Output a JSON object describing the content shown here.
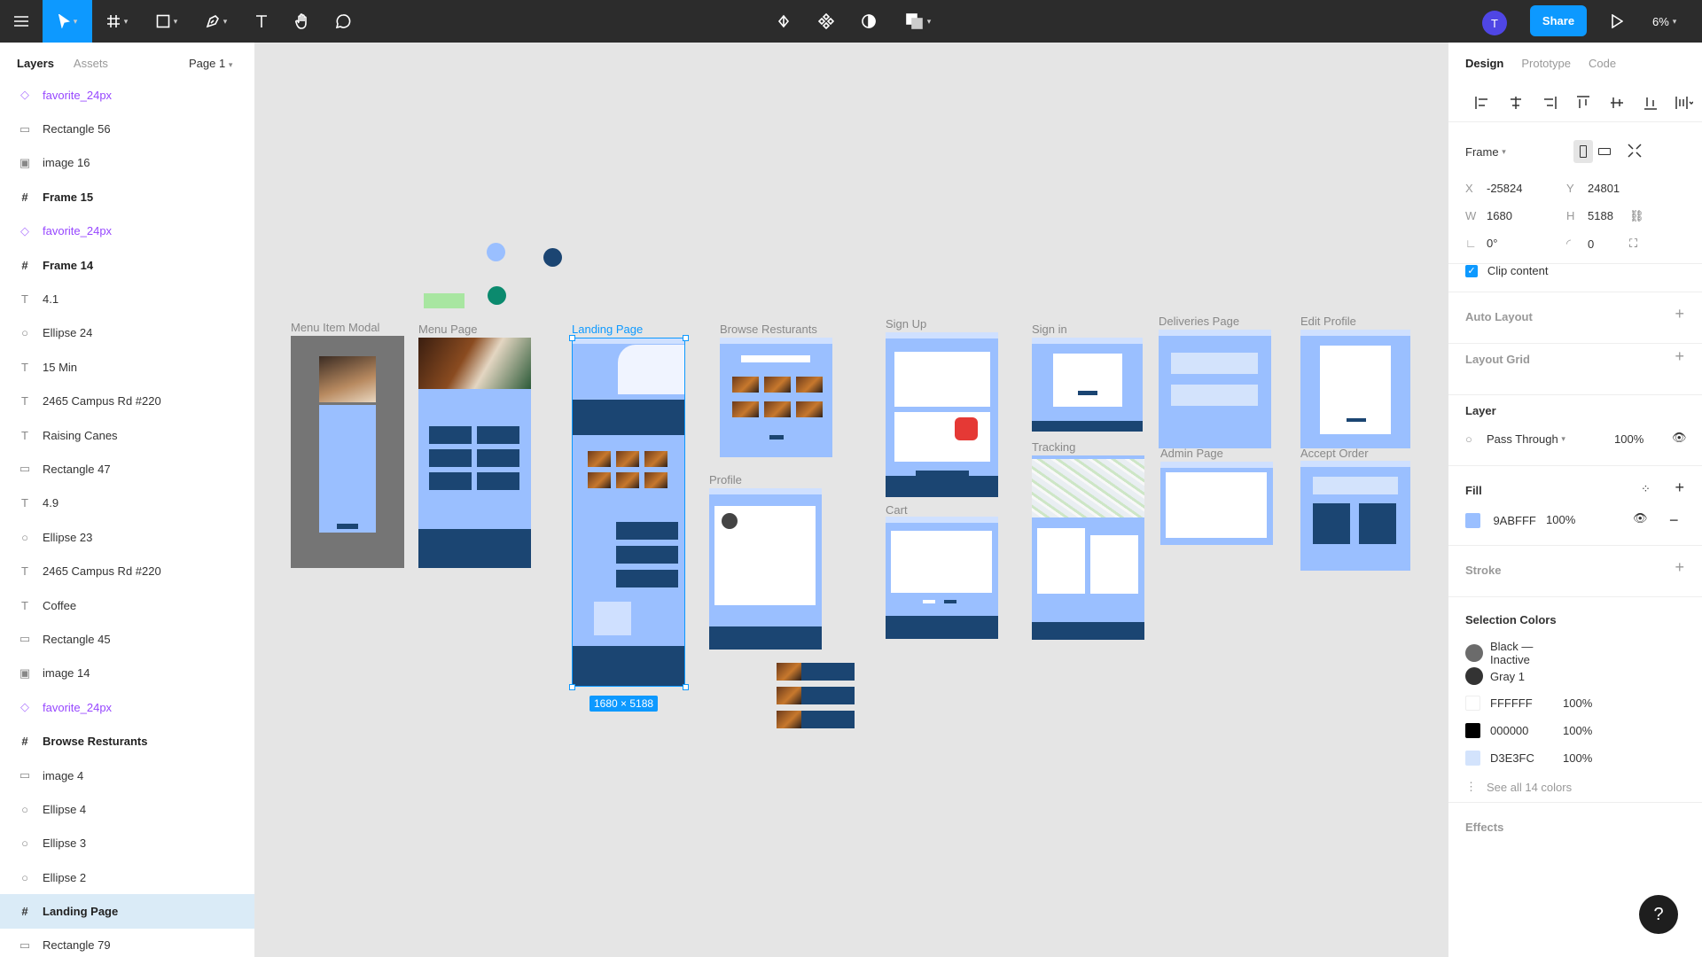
{
  "toolbar": {
    "share_label": "Share",
    "avatar_initial": "T",
    "zoom": "6%"
  },
  "left_panel": {
    "tabs": [
      "Layers",
      "Assets"
    ],
    "page": "Page 1",
    "layers": [
      {
        "name": "favorite_24px",
        "type": "component"
      },
      {
        "name": "Rectangle 56",
        "type": "rectangle"
      },
      {
        "name": "image 16",
        "type": "image"
      },
      {
        "name": "Frame 15",
        "type": "frame"
      },
      {
        "name": "favorite_24px",
        "type": "component"
      },
      {
        "name": "Frame 14",
        "type": "frame"
      },
      {
        "name": "4.1",
        "type": "text"
      },
      {
        "name": "Ellipse 24",
        "type": "ellipse"
      },
      {
        "name": "15 Min",
        "type": "text"
      },
      {
        "name": "2465 Campus Rd #220",
        "type": "text"
      },
      {
        "name": "Raising Canes",
        "type": "text"
      },
      {
        "name": "Rectangle 47",
        "type": "rectangle"
      },
      {
        "name": "4.9",
        "type": "text"
      },
      {
        "name": "Ellipse 23",
        "type": "ellipse"
      },
      {
        "name": "2465 Campus Rd #220",
        "type": "text"
      },
      {
        "name": "Coffee",
        "type": "text"
      },
      {
        "name": "Rectangle 45",
        "type": "rectangle"
      },
      {
        "name": "image 14",
        "type": "image"
      },
      {
        "name": "favorite_24px",
        "type": "component"
      },
      {
        "name": "Browse Resturants",
        "type": "frame"
      },
      {
        "name": "image 4",
        "type": "rectangle"
      },
      {
        "name": "Ellipse 4",
        "type": "ellipse"
      },
      {
        "name": "Ellipse 3",
        "type": "ellipse"
      },
      {
        "name": "Ellipse 2",
        "type": "ellipse"
      },
      {
        "name": "Landing Page",
        "type": "frame",
        "selected": true
      },
      {
        "name": "Rectangle 79",
        "type": "rectangle"
      }
    ]
  },
  "canvas": {
    "frames": {
      "menu_item_modal": "Menu Item Modal",
      "menu_page": "Menu Page",
      "landing_page": "Landing Page",
      "browse": "Browse Resturants",
      "profile": "Profile",
      "sign_up": "Sign Up",
      "cart": "Cart",
      "sign_in": "Sign in",
      "tracking": "Tracking",
      "deliveries": "Deliveries Page",
      "admin": "Admin Page",
      "edit_profile": "Edit Profile",
      "accept_order": "Accept Order"
    },
    "selection_size": "1680 × 5188",
    "colors": {
      "light_blue": "#9abfff",
      "navy": "#1b4572",
      "green": "#a8e6a1",
      "teal": "#0b8a6e"
    }
  },
  "right_panel": {
    "tabs": [
      "Design",
      "Prototype",
      "Code"
    ],
    "frame_label": "Frame",
    "x": "-25824",
    "y": "24801",
    "w": "1680",
    "h": "5188",
    "rotation": "0°",
    "radius": "0",
    "clip_content": "Clip content",
    "auto_layout": "Auto Layout",
    "layout_grid": "Layout Grid",
    "layer": {
      "title": "Layer",
      "blend": "Pass Through",
      "opacity": "100%"
    },
    "fill": {
      "title": "Fill",
      "hex": "9ABFFF",
      "opacity": "100%",
      "color": "#9abfff"
    },
    "stroke": "Stroke",
    "selection_colors": {
      "title": "Selection Colors",
      "items": [
        {
          "label": "Black — Inactive",
          "color": "#6b6b6b",
          "style": true
        },
        {
          "label": "Gray 1",
          "color": "#333333",
          "style": true
        },
        {
          "label": "FFFFFF",
          "opacity": "100%",
          "color": "#ffffff"
        },
        {
          "label": "000000",
          "opacity": "100%",
          "color": "#000000"
        },
        {
          "label": "D3E3FC",
          "opacity": "100%",
          "color": "#d3e3fc"
        }
      ],
      "see_all": "See all 14 colors"
    },
    "effects": "Effects",
    "help": "?"
  }
}
